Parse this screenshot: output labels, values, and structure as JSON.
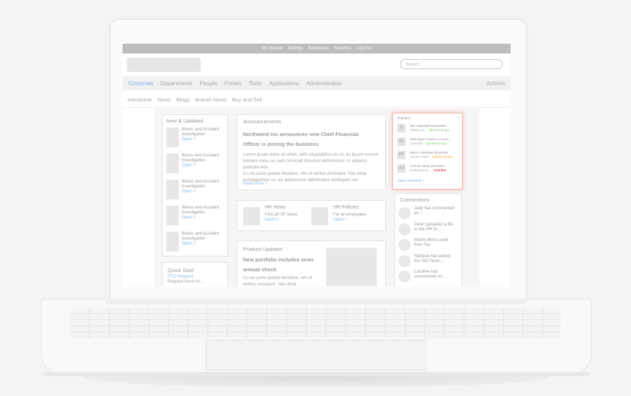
{
  "topbar": {
    "links": [
      "My Intranet",
      "Settings",
      "Bookmarks",
      "Favorites",
      "Log Out"
    ]
  },
  "search": {
    "placeholder": "Search"
  },
  "nav_primary": {
    "items": [
      "Corporate",
      "Departments",
      "People",
      "Portals",
      "Tools",
      "Applications",
      "Administration"
    ],
    "active": "Corporate",
    "actions": "Actions"
  },
  "nav_secondary": {
    "items": [
      "Interactive",
      "News",
      "Blogs",
      "Branch News",
      "Buy and Sell"
    ]
  },
  "new_updated": {
    "title": "New & Updated",
    "items": [
      {
        "title": "Illness and Accident Investigation",
        "link": "Open >"
      },
      {
        "title": "Illness and Accident Investigation",
        "link": "Open >"
      },
      {
        "title": "Illness and Accident Investigation",
        "link": "Open >"
      },
      {
        "title": "Illness and Accident Investigation",
        "link": "Open >"
      },
      {
        "title": "Illness and Accident Investigation",
        "link": "Open >"
      }
    ]
  },
  "quick_start": {
    "title": "Quick Start",
    "link": "PTO Request",
    "text": "Request more An..."
  },
  "announcements": {
    "title": "Announcements",
    "headline": "Northwind Inc announces new Chief Financial Officer is joining the business",
    "body1": "Lorem ipsum dolor sit amet, velit voluptatibus vis ut, eu ipsum novum homero mea, no nam nominati tincidunt definitiones. In aeterno prompta eos.",
    "body2": "Cu vis purto putant tincidunt, vim id veritus postulant. Has dicta consequuntur cu, ex adolescens abhorreant intellegam vel.",
    "more": "Read more >"
  },
  "hr": {
    "news": {
      "title": "HR News",
      "subtitle": "Find all HR News",
      "link": "Open >"
    },
    "policies": {
      "title": "HR Policies",
      "subtitle": "For all employees",
      "link": "Open >"
    }
  },
  "product_updates": {
    "title": "Product Updates",
    "headline": "New portfolio includes semi-annual check",
    "body": "Cu vis purto putant tincidunt, vim id veritus postulant. Has dicta"
  },
  "helpdesk": {
    "title": "Helpdesk",
    "close": "×",
    "items": [
      {
        "initials": "TI",
        "title": "Max capacity/incapacitated",
        "sub": "Tailspin Inc.",
        "status": "Opened 16 ago",
        "status_color": "#7bc96a"
      },
      {
        "initials": "GI",
        "title": "Task import function is frozen",
        "sub": "Gamerlife",
        "status": "Opened 26 ago",
        "status_color": "#7bc96a"
      },
      {
        "initials": "FF",
        "title": "Warp in database dimension",
        "sub": "Franks Franks",
        "status": "Opened 35 ago",
        "status_color": "#f2a33a"
      },
      {
        "initials": "AJ",
        "title": "Currents haste generated",
        "sub": "Northwind Inc...",
        "status": "Overdue",
        "status_color": "#e0443a"
      }
    ],
    "open_link": "Open Helpdesk >"
  },
  "connections": {
    "title": "Connections",
    "items": [
      "Judy has commented on...",
      "Peter uploaded a file to the HR Gr...",
      "Martin liked a post from Tim",
      "Stefanie has joined the ISO Team...",
      "Caroline has commented on..."
    ]
  },
  "colors": {
    "accent": "#8cbbe9",
    "topbar": "#bdbdbd",
    "helpdesk_border": "#f4b2a8"
  }
}
